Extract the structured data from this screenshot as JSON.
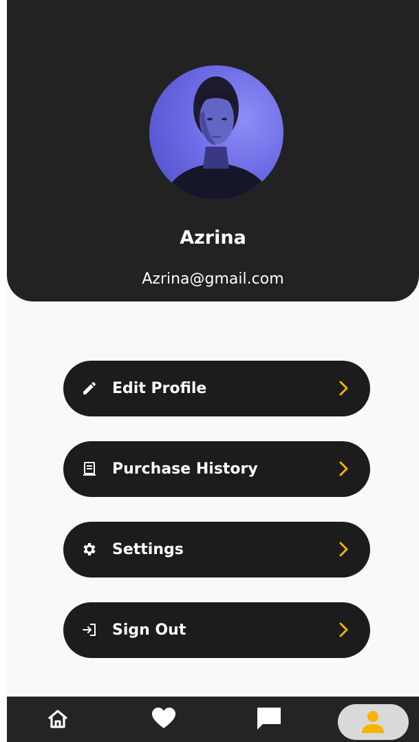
{
  "profile": {
    "name": "Azrina",
    "email": "Azrina@gmail.com"
  },
  "menu": {
    "items": [
      {
        "label": "Edit Profile",
        "icon": "pencil-icon"
      },
      {
        "label": "Purchase History",
        "icon": "receipt-icon"
      },
      {
        "label": "Settings",
        "icon": "gear-icon"
      },
      {
        "label": "Sign Out",
        "icon": "sign-out-icon"
      }
    ]
  },
  "bottom_nav": {
    "items": [
      {
        "icon": "home-icon"
      },
      {
        "icon": "heart-icon"
      },
      {
        "icon": "chat-icon"
      },
      {
        "icon": "person-icon",
        "active": true
      }
    ]
  },
  "colors": {
    "header_bg": "#222222",
    "button_bg": "#1c1c1c",
    "accent": "#f5b400",
    "nav_bg": "#242424",
    "nav_active_pill": "#d9d9d9"
  }
}
